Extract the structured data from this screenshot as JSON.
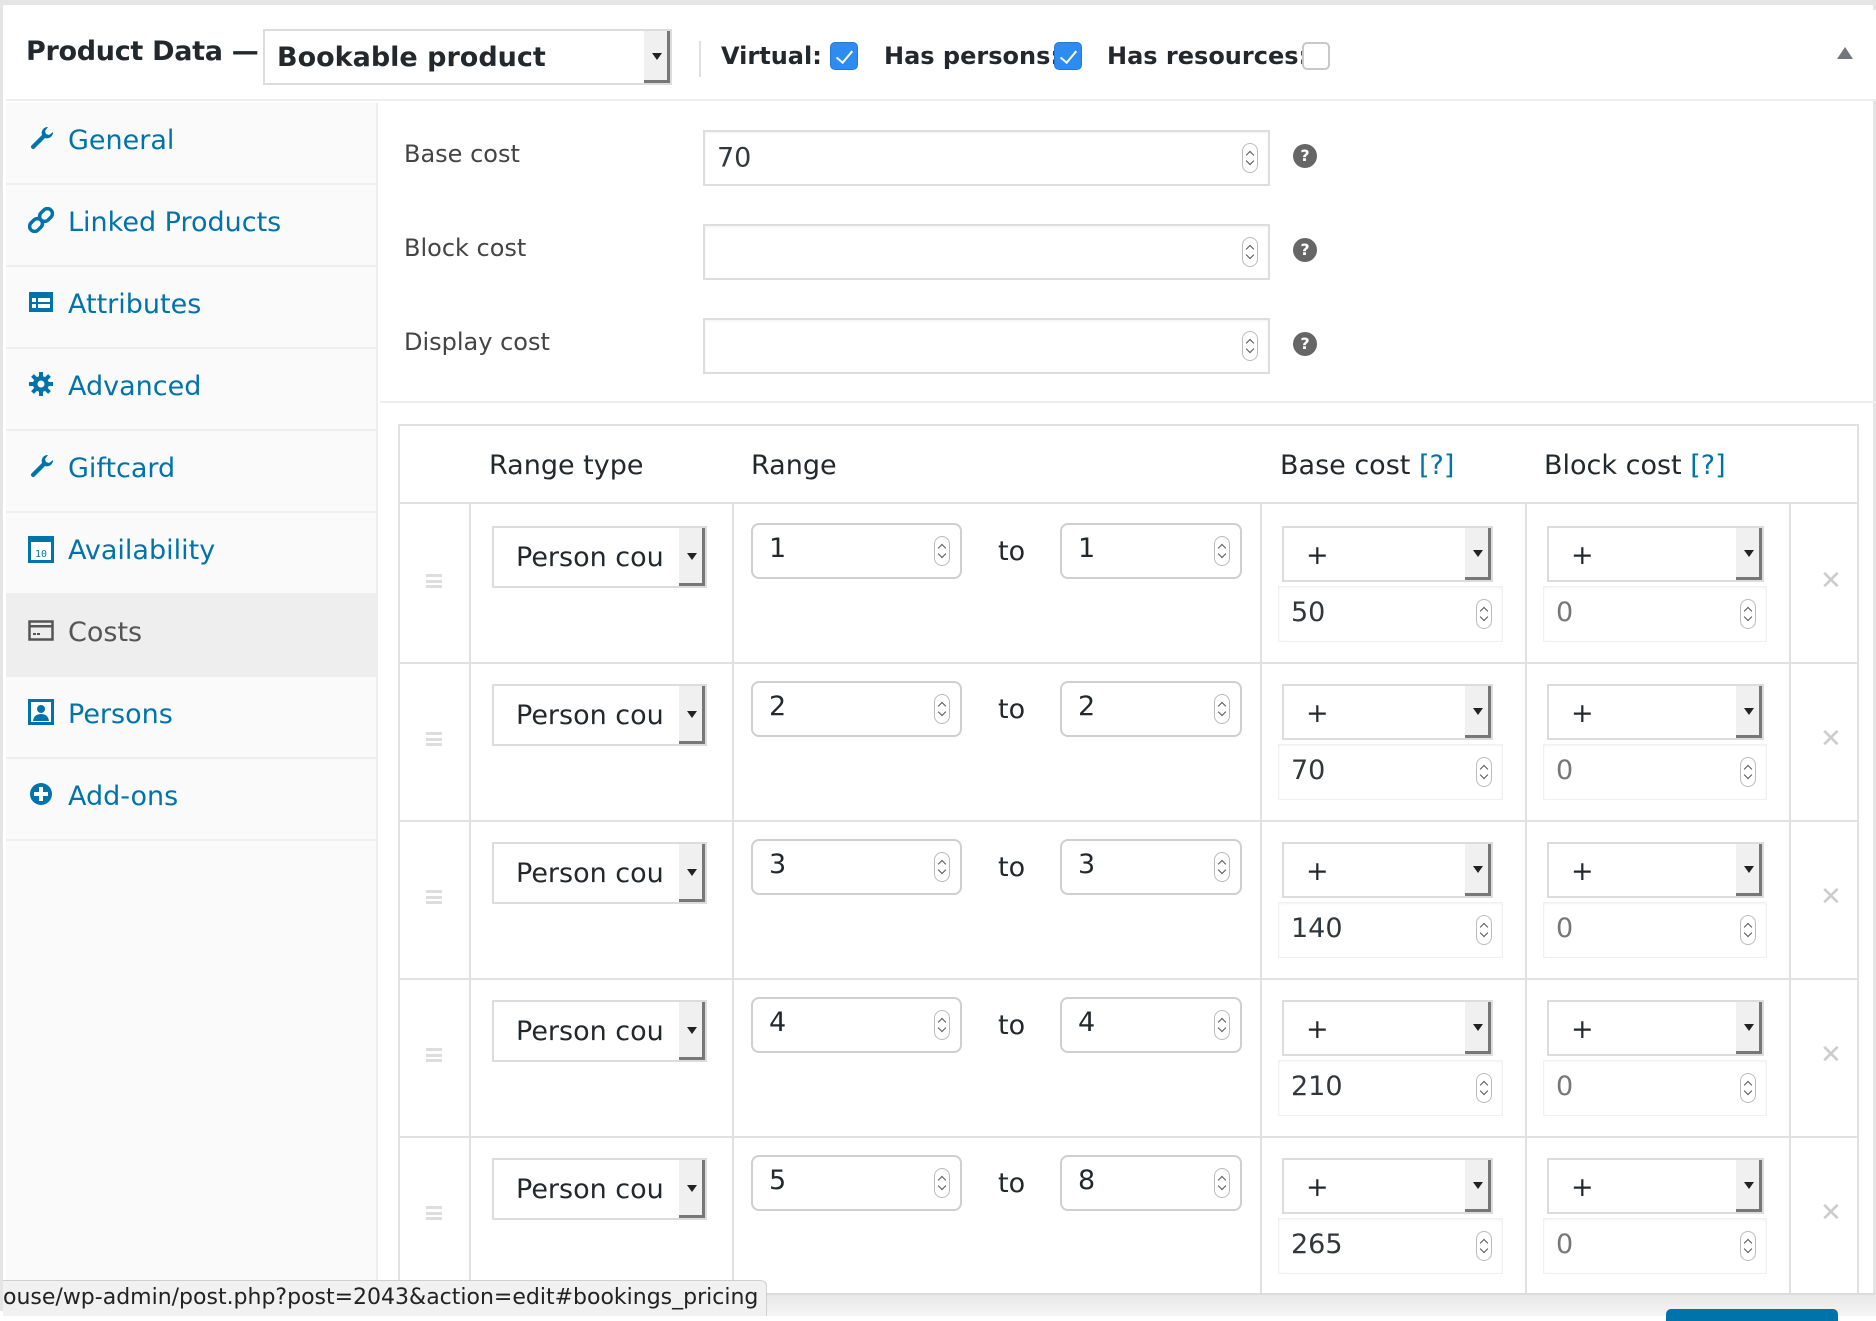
{
  "header": {
    "title": "Product Data —",
    "product_type": "Bookable product",
    "options": [
      {
        "label": "Virtual:",
        "checked": true
      },
      {
        "label": "Has persons:",
        "checked": true
      },
      {
        "label": "Has resources:",
        "checked": false
      }
    ],
    "collapse_icon": "triangle-up"
  },
  "sidebar": {
    "items": [
      {
        "label": "General",
        "icon": "wrench-icon",
        "active": false
      },
      {
        "label": "Linked Products",
        "icon": "link-icon",
        "active": false
      },
      {
        "label": "Attributes",
        "icon": "list-table-icon",
        "active": false
      },
      {
        "label": "Advanced",
        "icon": "gear-icon",
        "active": false
      },
      {
        "label": "Giftcard",
        "icon": "wrench-icon",
        "active": false
      },
      {
        "label": "Availability",
        "icon": "calendar-icon",
        "active": false
      },
      {
        "label": "Costs",
        "icon": "credit-card-icon",
        "active": true
      },
      {
        "label": "Persons",
        "icon": "person-icon",
        "active": false
      },
      {
        "label": "Add-ons",
        "icon": "plus-circle-icon",
        "active": false
      }
    ]
  },
  "fields": [
    {
      "label": "Base cost",
      "value": "70"
    },
    {
      "label": "Block cost",
      "value": ""
    },
    {
      "label": "Display cost",
      "value": ""
    }
  ],
  "help_glyph": "?",
  "table": {
    "headers": {
      "range_type": "Range type",
      "range": "Range",
      "base_cost": "Base cost",
      "block_cost": "Block cost",
      "help_link": "[?]"
    },
    "to_label": "to",
    "delete_glyph": "✕",
    "rows": [
      {
        "range_type": "Person cou",
        "from": "1",
        "to": "1",
        "base_modifier": "+",
        "base_cost": "50",
        "block_modifier": "+",
        "block_cost": "0"
      },
      {
        "range_type": "Person cou",
        "from": "2",
        "to": "2",
        "base_modifier": "+",
        "base_cost": "70",
        "block_modifier": "+",
        "block_cost": "0"
      },
      {
        "range_type": "Person cou",
        "from": "3",
        "to": "3",
        "base_modifier": "+",
        "base_cost": "140",
        "block_modifier": "+",
        "block_cost": "0"
      },
      {
        "range_type": "Person cou",
        "from": "4",
        "to": "4",
        "base_modifier": "+",
        "base_cost": "210",
        "block_modifier": "+",
        "block_cost": "0"
      },
      {
        "range_type": "Person cou",
        "from": "5",
        "to": "8",
        "base_modifier": "+",
        "base_cost": "265",
        "block_modifier": "+",
        "block_cost": "0"
      }
    ]
  },
  "status_bar": {
    "url": "ouse/wp-admin/post.php?post=2043&action=edit#bookings_pricing"
  },
  "colors": {
    "link": "#0073aa",
    "checkbox_on": "#2e8cf0",
    "active_tab_bg": "#eeeeee"
  }
}
